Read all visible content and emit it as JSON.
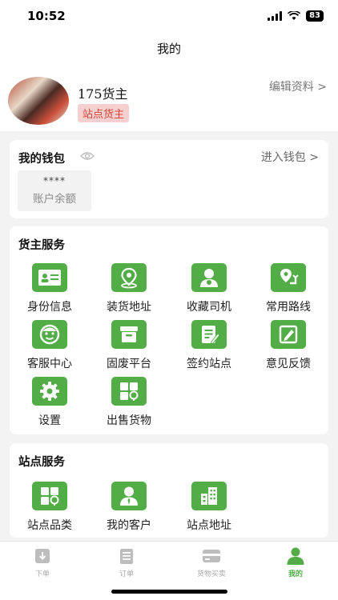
{
  "status": {
    "time": "10:52",
    "battery": "83"
  },
  "nav": {
    "title": "我的"
  },
  "profile": {
    "name": "175货主",
    "badge": "站点货主",
    "edit": "编辑资料 >"
  },
  "wallet": {
    "title": "我的钱包",
    "enter": "进入钱包 >",
    "balance_masked": "****",
    "balance_label": "账户余额"
  },
  "shipper_services": {
    "title": "货主服务",
    "items": [
      {
        "label": "身份信息",
        "icon": "id-card-icon"
      },
      {
        "label": "装货地址",
        "icon": "location-pin-icon"
      },
      {
        "label": "收藏司机",
        "icon": "driver-icon"
      },
      {
        "label": "常用路线",
        "icon": "route-icon"
      },
      {
        "label": "客服中心",
        "icon": "customer-service-icon"
      },
      {
        "label": "固废平台",
        "icon": "archive-box-icon"
      },
      {
        "label": "签约站点",
        "icon": "contract-icon"
      },
      {
        "label": "意见反馈",
        "icon": "edit-pen-icon"
      },
      {
        "label": "设置",
        "icon": "gear-icon"
      },
      {
        "label": "出售货物",
        "icon": "sell-goods-icon"
      }
    ]
  },
  "station_services": {
    "title": "站点服务",
    "items": [
      {
        "label": "站点品类",
        "icon": "category-icon"
      },
      {
        "label": "我的客户",
        "icon": "customer-icon"
      },
      {
        "label": "站点地址",
        "icon": "building-icon"
      }
    ]
  },
  "tabbar": {
    "items": [
      {
        "label": "下单",
        "icon": "order-download-icon"
      },
      {
        "label": "订单",
        "icon": "clipboard-icon"
      },
      {
        "label": "货物买卖",
        "icon": "trade-icon"
      },
      {
        "label": "我的",
        "icon": "person-icon"
      }
    ]
  },
  "colors": {
    "accent": "#52ad47",
    "badge_bg": "#f6cfcf",
    "badge_text": "#d6443a"
  }
}
